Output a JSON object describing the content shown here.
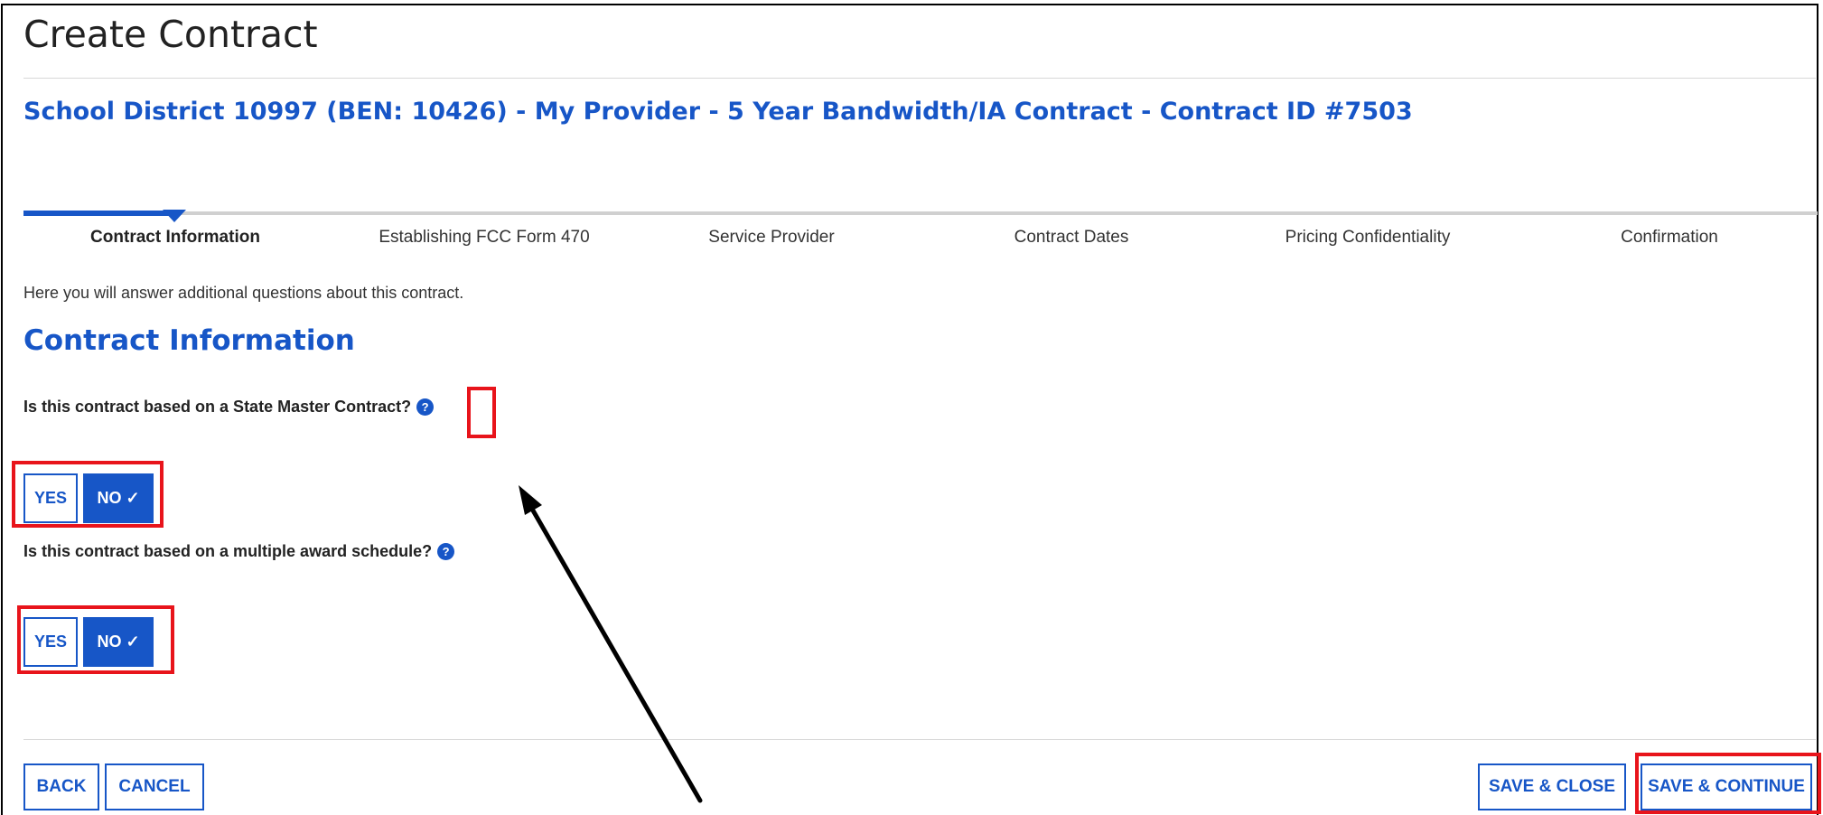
{
  "header": {
    "title": "Create Contract",
    "contract_title": "School District 10997 (BEN: 10426) - My Provider - 5 Year Bandwidth/IA Contract - Contract ID #7503"
  },
  "steps": [
    {
      "label": "Contract Information",
      "active": true
    },
    {
      "label": "Establishing FCC Form 470",
      "active": false
    },
    {
      "label": "Service Provider",
      "active": false
    },
    {
      "label": "Contract Dates",
      "active": false
    },
    {
      "label": "Pricing Confidentiality",
      "active": false
    },
    {
      "label": "Confirmation",
      "active": false
    }
  ],
  "intro_text": "Here you will answer additional questions about this contract.",
  "section": {
    "title": "Contract Information"
  },
  "questions": [
    {
      "text": "Is this contract based on a State Master Contract?",
      "yes_label": "YES",
      "no_label": "NO ✓",
      "selected": "NO"
    },
    {
      "text": "Is this contract based on a multiple award schedule?",
      "yes_label": "YES",
      "no_label": "NO ✓",
      "selected": "NO"
    }
  ],
  "help_icon_glyph": "?",
  "actions": {
    "back": "BACK",
    "cancel": "CANCEL",
    "save_close": "SAVE & CLOSE",
    "save_continue": "SAVE & CONTINUE"
  },
  "colors": {
    "accent": "#1756c7",
    "highlight": "#e8141b",
    "arrow": "#000000"
  }
}
